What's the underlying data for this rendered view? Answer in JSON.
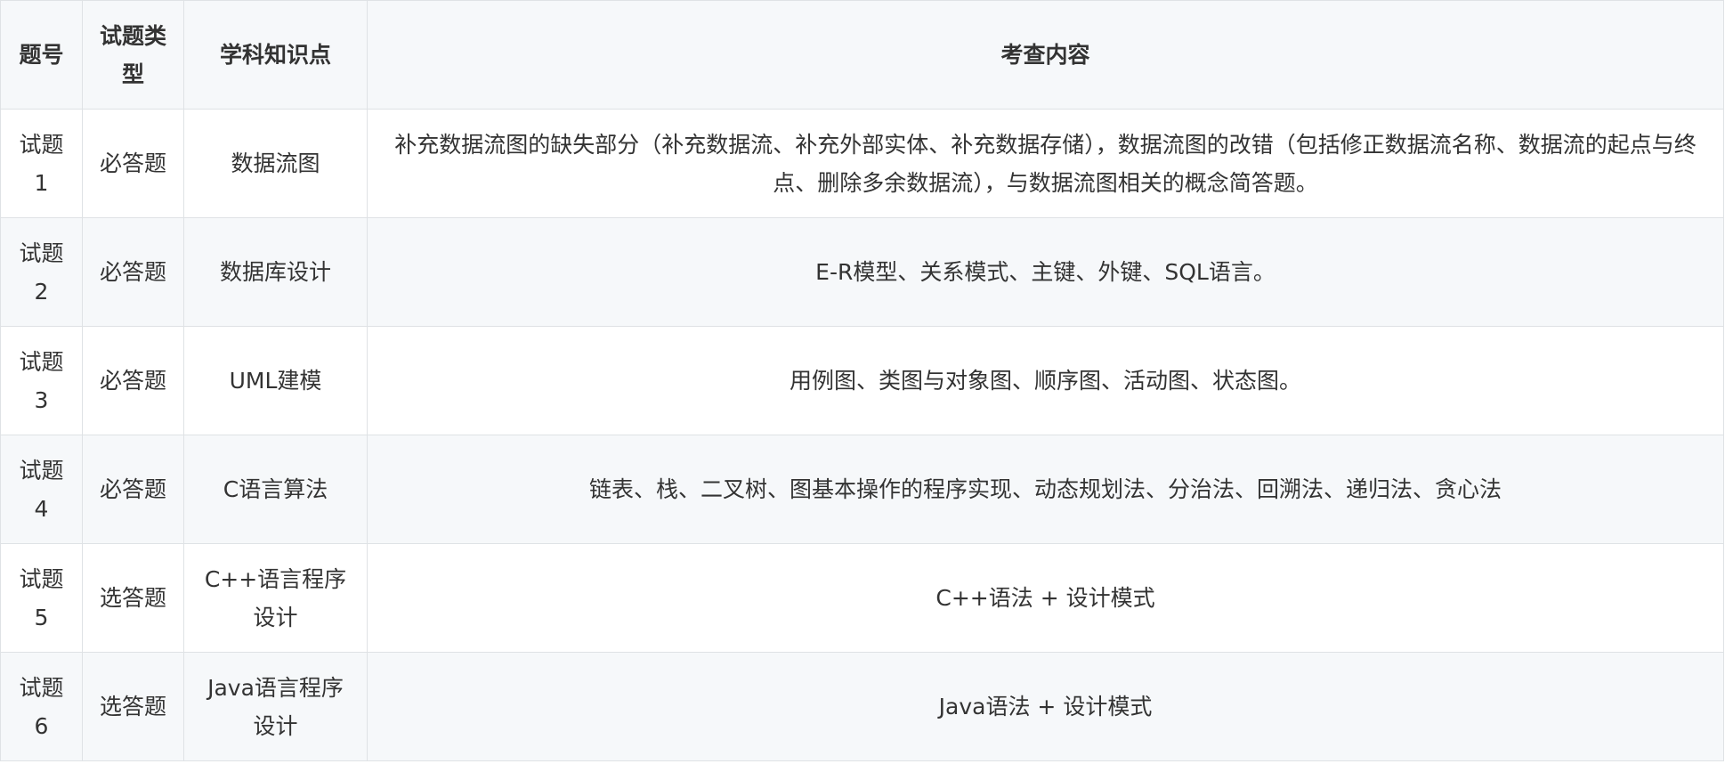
{
  "table": {
    "headers": {
      "no": "题号",
      "type": "试题类型",
      "topic": "学科知识点",
      "content": "考查内容"
    },
    "rows": [
      {
        "no": "试题1",
        "type": "必答题",
        "topic": "数据流图",
        "content": "补充数据流图的缺失部分（补充数据流、补充外部实体、补充数据存储），数据流图的改错（包括修正数据流名称、数据流的起点与终点、删除多余数据流），与数据流图相关的概念简答题。"
      },
      {
        "no": "试题2",
        "type": "必答题",
        "topic": "数据库设计",
        "content": "E-R模型、关系模式、主键、外键、SQL语言。"
      },
      {
        "no": "试题3",
        "type": "必答题",
        "topic": "UML建模",
        "content": "用例图、类图与对象图、顺序图、活动图、状态图。"
      },
      {
        "no": "试题4",
        "type": "必答题",
        "topic": "C语言算法",
        "content": "链表、栈、二叉树、图基本操作的程序实现、动态规划法、分治法、回溯法、递归法、贪心法"
      },
      {
        "no": "试题5",
        "type": "选答题",
        "topic": "C++语言程序设计",
        "content": "C++语法 + 设计模式"
      },
      {
        "no": "试题6",
        "type": "选答题",
        "topic": "Java语言程序设计",
        "content": "Java语法 + 设计模式"
      }
    ]
  },
  "colors": {
    "border": "#dfe2e5",
    "header_bg": "#f6f8fa",
    "stripe_bg": "#f6f8fa",
    "text": "#333333"
  }
}
